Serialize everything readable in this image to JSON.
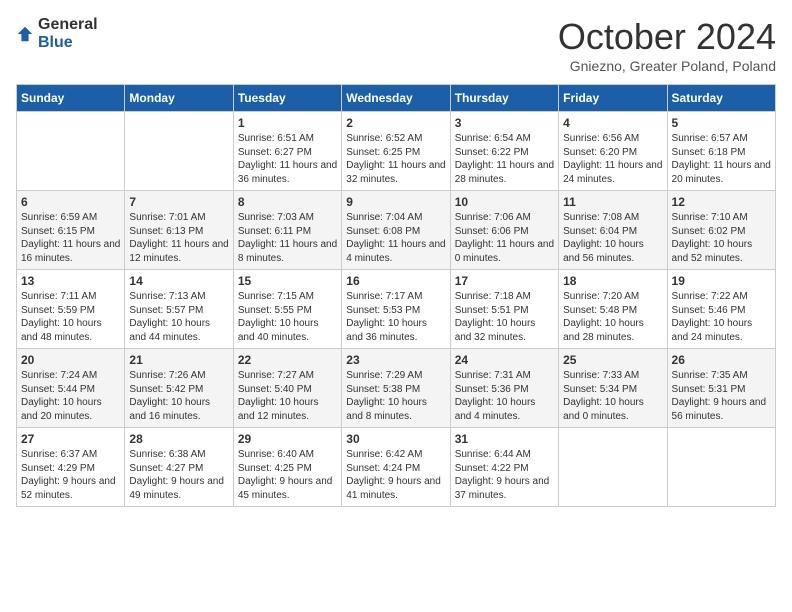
{
  "header": {
    "logo_general": "General",
    "logo_blue": "Blue",
    "month": "October 2024",
    "location": "Gniezno, Greater Poland, Poland"
  },
  "days_of_week": [
    "Sunday",
    "Monday",
    "Tuesday",
    "Wednesday",
    "Thursday",
    "Friday",
    "Saturday"
  ],
  "weeks": [
    [
      {
        "day": "",
        "sunrise": "",
        "sunset": "",
        "daylight": ""
      },
      {
        "day": "",
        "sunrise": "",
        "sunset": "",
        "daylight": ""
      },
      {
        "day": "1",
        "sunrise": "Sunrise: 6:51 AM",
        "sunset": "Sunset: 6:27 PM",
        "daylight": "Daylight: 11 hours and 36 minutes."
      },
      {
        "day": "2",
        "sunrise": "Sunrise: 6:52 AM",
        "sunset": "Sunset: 6:25 PM",
        "daylight": "Daylight: 11 hours and 32 minutes."
      },
      {
        "day": "3",
        "sunrise": "Sunrise: 6:54 AM",
        "sunset": "Sunset: 6:22 PM",
        "daylight": "Daylight: 11 hours and 28 minutes."
      },
      {
        "day": "4",
        "sunrise": "Sunrise: 6:56 AM",
        "sunset": "Sunset: 6:20 PM",
        "daylight": "Daylight: 11 hours and 24 minutes."
      },
      {
        "day": "5",
        "sunrise": "Sunrise: 6:57 AM",
        "sunset": "Sunset: 6:18 PM",
        "daylight": "Daylight: 11 hours and 20 minutes."
      }
    ],
    [
      {
        "day": "6",
        "sunrise": "Sunrise: 6:59 AM",
        "sunset": "Sunset: 6:15 PM",
        "daylight": "Daylight: 11 hours and 16 minutes."
      },
      {
        "day": "7",
        "sunrise": "Sunrise: 7:01 AM",
        "sunset": "Sunset: 6:13 PM",
        "daylight": "Daylight: 11 hours and 12 minutes."
      },
      {
        "day": "8",
        "sunrise": "Sunrise: 7:03 AM",
        "sunset": "Sunset: 6:11 PM",
        "daylight": "Daylight: 11 hours and 8 minutes."
      },
      {
        "day": "9",
        "sunrise": "Sunrise: 7:04 AM",
        "sunset": "Sunset: 6:08 PM",
        "daylight": "Daylight: 11 hours and 4 minutes."
      },
      {
        "day": "10",
        "sunrise": "Sunrise: 7:06 AM",
        "sunset": "Sunset: 6:06 PM",
        "daylight": "Daylight: 11 hours and 0 minutes."
      },
      {
        "day": "11",
        "sunrise": "Sunrise: 7:08 AM",
        "sunset": "Sunset: 6:04 PM",
        "daylight": "Daylight: 10 hours and 56 minutes."
      },
      {
        "day": "12",
        "sunrise": "Sunrise: 7:10 AM",
        "sunset": "Sunset: 6:02 PM",
        "daylight": "Daylight: 10 hours and 52 minutes."
      }
    ],
    [
      {
        "day": "13",
        "sunrise": "Sunrise: 7:11 AM",
        "sunset": "Sunset: 5:59 PM",
        "daylight": "Daylight: 10 hours and 48 minutes."
      },
      {
        "day": "14",
        "sunrise": "Sunrise: 7:13 AM",
        "sunset": "Sunset: 5:57 PM",
        "daylight": "Daylight: 10 hours and 44 minutes."
      },
      {
        "day": "15",
        "sunrise": "Sunrise: 7:15 AM",
        "sunset": "Sunset: 5:55 PM",
        "daylight": "Daylight: 10 hours and 40 minutes."
      },
      {
        "day": "16",
        "sunrise": "Sunrise: 7:17 AM",
        "sunset": "Sunset: 5:53 PM",
        "daylight": "Daylight: 10 hours and 36 minutes."
      },
      {
        "day": "17",
        "sunrise": "Sunrise: 7:18 AM",
        "sunset": "Sunset: 5:51 PM",
        "daylight": "Daylight: 10 hours and 32 minutes."
      },
      {
        "day": "18",
        "sunrise": "Sunrise: 7:20 AM",
        "sunset": "Sunset: 5:48 PM",
        "daylight": "Daylight: 10 hours and 28 minutes."
      },
      {
        "day": "19",
        "sunrise": "Sunrise: 7:22 AM",
        "sunset": "Sunset: 5:46 PM",
        "daylight": "Daylight: 10 hours and 24 minutes."
      }
    ],
    [
      {
        "day": "20",
        "sunrise": "Sunrise: 7:24 AM",
        "sunset": "Sunset: 5:44 PM",
        "daylight": "Daylight: 10 hours and 20 minutes."
      },
      {
        "day": "21",
        "sunrise": "Sunrise: 7:26 AM",
        "sunset": "Sunset: 5:42 PM",
        "daylight": "Daylight: 10 hours and 16 minutes."
      },
      {
        "day": "22",
        "sunrise": "Sunrise: 7:27 AM",
        "sunset": "Sunset: 5:40 PM",
        "daylight": "Daylight: 10 hours and 12 minutes."
      },
      {
        "day": "23",
        "sunrise": "Sunrise: 7:29 AM",
        "sunset": "Sunset: 5:38 PM",
        "daylight": "Daylight: 10 hours and 8 minutes."
      },
      {
        "day": "24",
        "sunrise": "Sunrise: 7:31 AM",
        "sunset": "Sunset: 5:36 PM",
        "daylight": "Daylight: 10 hours and 4 minutes."
      },
      {
        "day": "25",
        "sunrise": "Sunrise: 7:33 AM",
        "sunset": "Sunset: 5:34 PM",
        "daylight": "Daylight: 10 hours and 0 minutes."
      },
      {
        "day": "26",
        "sunrise": "Sunrise: 7:35 AM",
        "sunset": "Sunset: 5:31 PM",
        "daylight": "Daylight: 9 hours and 56 minutes."
      }
    ],
    [
      {
        "day": "27",
        "sunrise": "Sunrise: 6:37 AM",
        "sunset": "Sunset: 4:29 PM",
        "daylight": "Daylight: 9 hours and 52 minutes."
      },
      {
        "day": "28",
        "sunrise": "Sunrise: 6:38 AM",
        "sunset": "Sunset: 4:27 PM",
        "daylight": "Daylight: 9 hours and 49 minutes."
      },
      {
        "day": "29",
        "sunrise": "Sunrise: 6:40 AM",
        "sunset": "Sunset: 4:25 PM",
        "daylight": "Daylight: 9 hours and 45 minutes."
      },
      {
        "day": "30",
        "sunrise": "Sunrise: 6:42 AM",
        "sunset": "Sunset: 4:24 PM",
        "daylight": "Daylight: 9 hours and 41 minutes."
      },
      {
        "day": "31",
        "sunrise": "Sunrise: 6:44 AM",
        "sunset": "Sunset: 4:22 PM",
        "daylight": "Daylight: 9 hours and 37 minutes."
      },
      {
        "day": "",
        "sunrise": "",
        "sunset": "",
        "daylight": ""
      },
      {
        "day": "",
        "sunrise": "",
        "sunset": "",
        "daylight": ""
      }
    ]
  ]
}
